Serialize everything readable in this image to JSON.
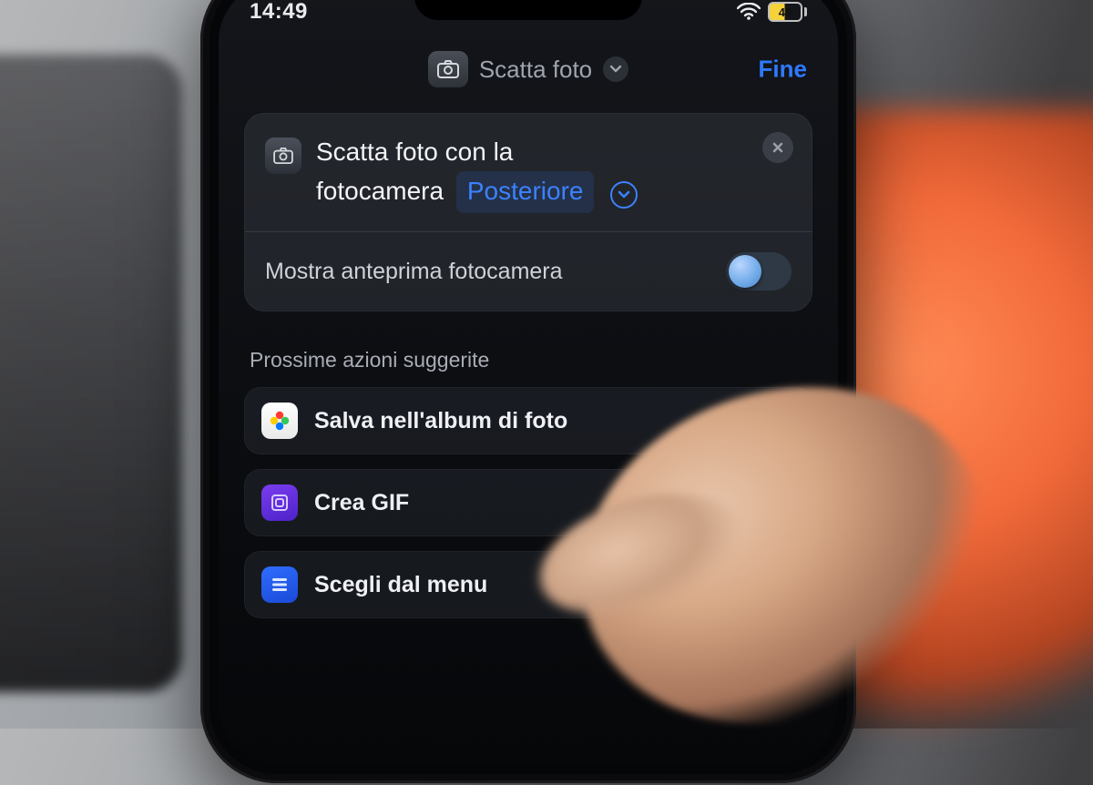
{
  "status": {
    "time": "14:49",
    "battery": "49"
  },
  "navbar": {
    "title": "Scatta foto",
    "done": "Fine"
  },
  "action_card": {
    "text_a": "Scatta foto con la",
    "text_b": "fotocamera",
    "param": "Posteriore",
    "preview_label": "Mostra anteprima fotocamera"
  },
  "suggestions": {
    "heading": "Prossime azioni suggerite",
    "items": [
      {
        "label": "Salva nell'album di foto"
      },
      {
        "label": "Crea GIF"
      },
      {
        "label": "Scegli dal menu"
      }
    ]
  }
}
